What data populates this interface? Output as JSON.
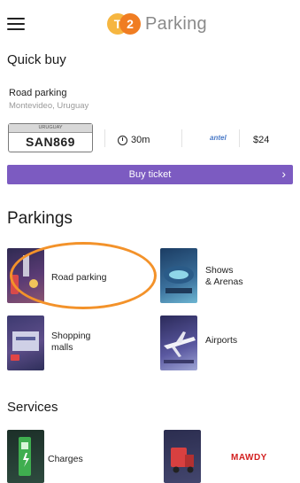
{
  "header": {
    "logo_mark_1": "T",
    "logo_mark_2": "2",
    "logo_text": "Parking"
  },
  "quick_buy": {
    "title": "Quick buy",
    "item_name": "Road parking",
    "item_location": "Montevideo, Uruguay",
    "plate_country": "URUGUAY",
    "plate_number": "SAN869",
    "duration": "30m",
    "carrier": "antel",
    "price": "$24",
    "buy_label": "Buy ticket",
    "buy_chevron": "›"
  },
  "parkings": {
    "title": "Parkings",
    "items": [
      {
        "label": "Road parking",
        "icon": "road-parking-image"
      },
      {
        "label": "Shows\n& Arenas",
        "icon": "arena-image"
      },
      {
        "label": "Shopping\nmalls",
        "icon": "mall-image"
      },
      {
        "label": "Airports",
        "icon": "airplane-image"
      }
    ]
  },
  "services": {
    "title": "Services",
    "items": [
      {
        "label": "Charges",
        "icon": "ev-charger-image"
      },
      {
        "label": "MAWDY",
        "icon": "roadside-assistance-image"
      }
    ]
  },
  "colors": {
    "accent": "#7c5bc1",
    "highlight": "#f3922a",
    "logo_orange": "#f07d22",
    "logo_yellow": "#f6b640"
  }
}
